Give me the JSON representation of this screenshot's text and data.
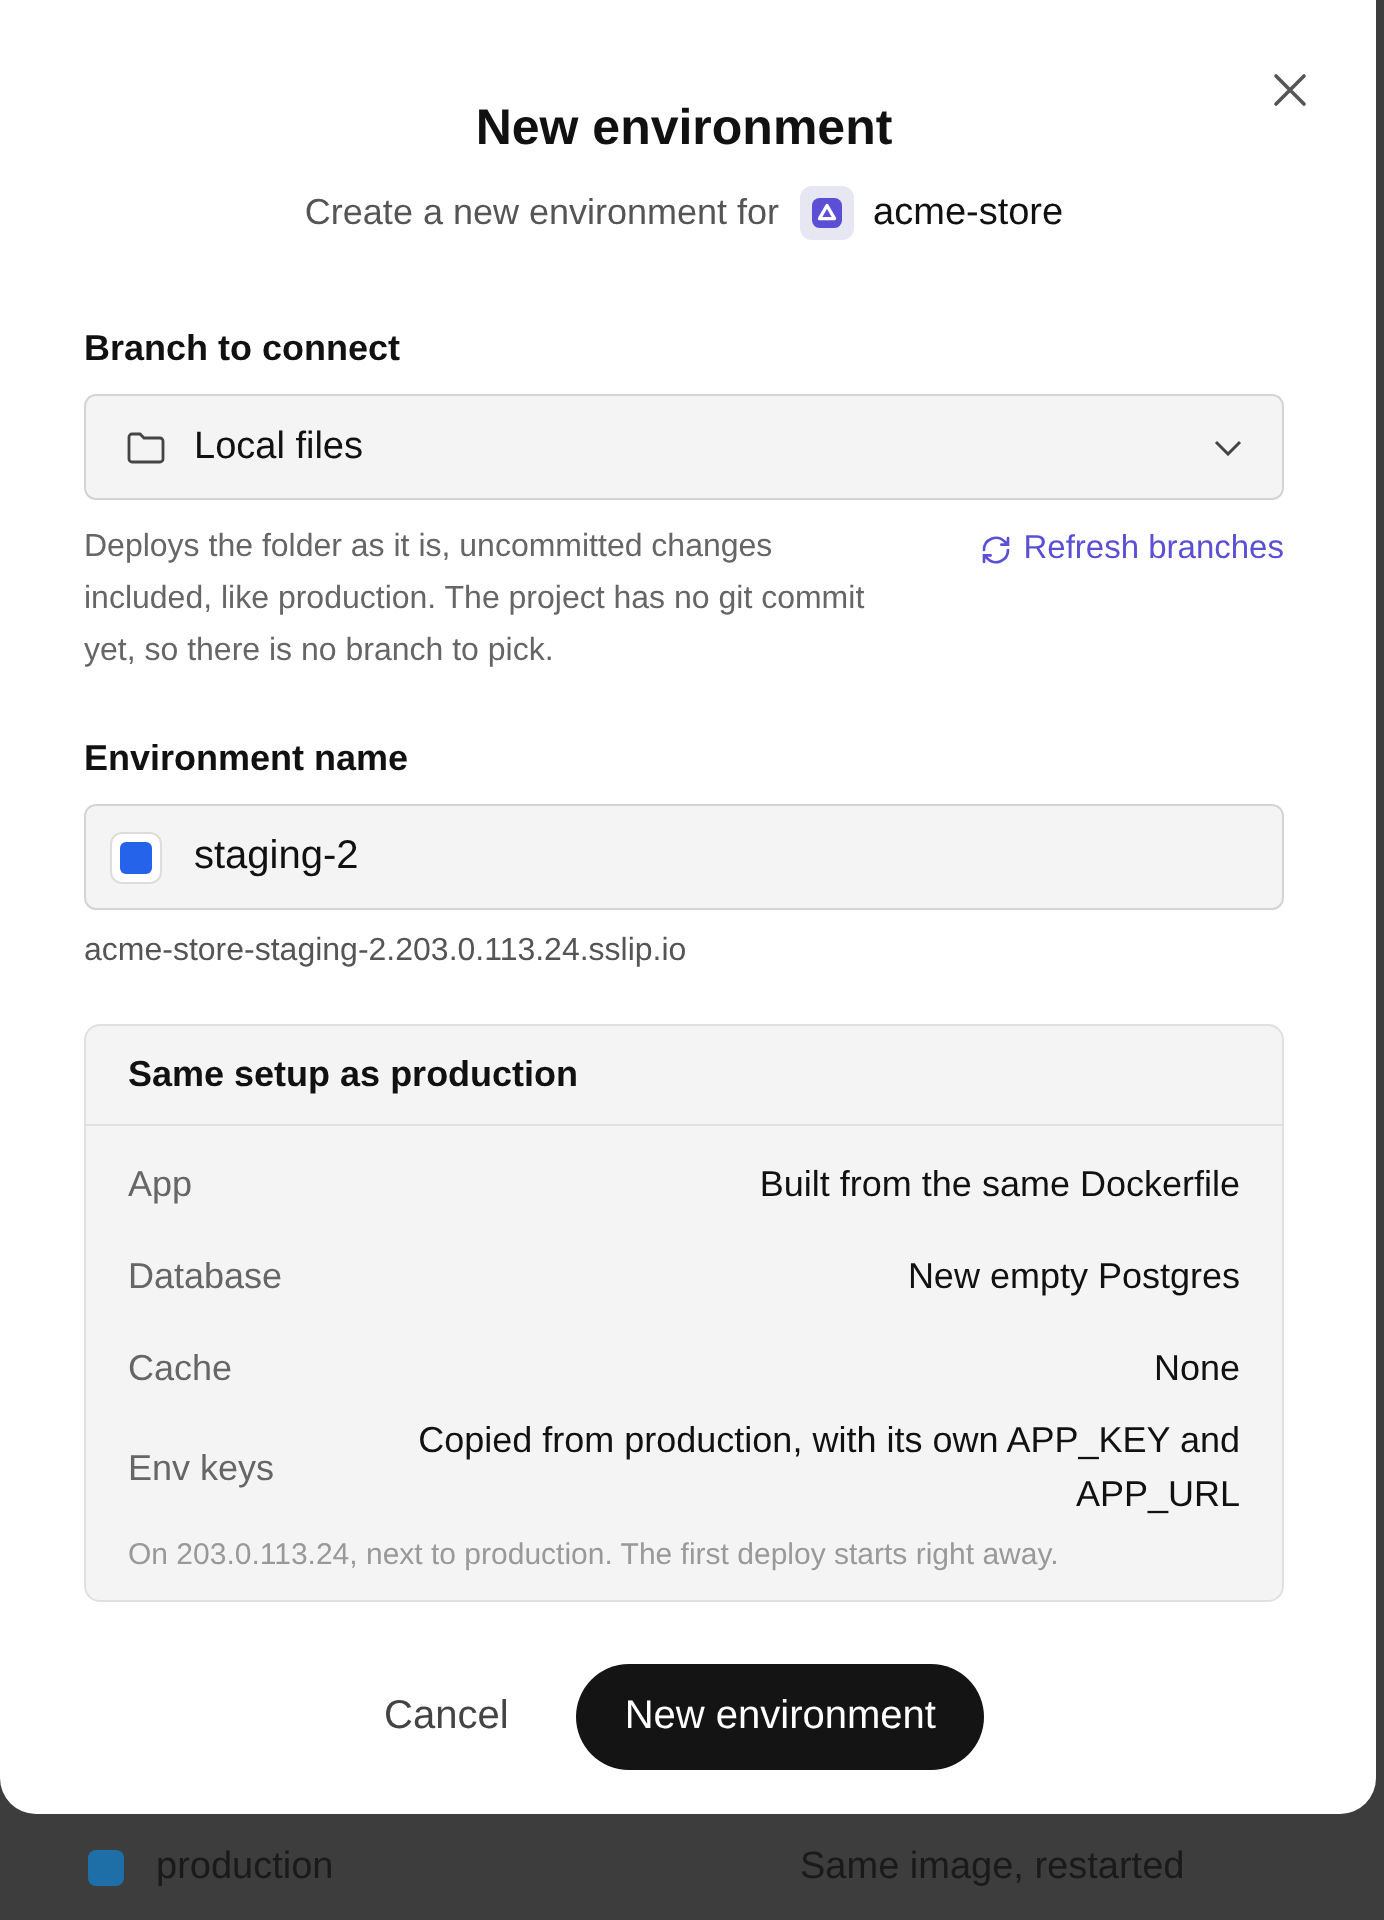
{
  "dialog": {
    "title": "New environment",
    "subtitle": "Create a new environment for",
    "project": "acme-store"
  },
  "branch": {
    "label": "Branch to connect",
    "value": "Local files",
    "hint": "Deploys the folder as it is, uncommitted changes included, like production. The project has no git commit yet, so there is no branch to pick.",
    "refresh": "Refresh branches"
  },
  "environment": {
    "label": "Environment name",
    "value": "staging-2",
    "color": "#2563eb",
    "url": "acme-store-staging-2.203.0.113.24.sslip.io"
  },
  "setup": {
    "title": "Same setup as production",
    "rows": [
      {
        "label": "App",
        "value": "Built from the same Dockerfile"
      },
      {
        "label": "Database",
        "value": "New empty Postgres"
      },
      {
        "label": "Cache",
        "value": "None"
      },
      {
        "label": "Env keys",
        "value": "Copied from production, with its own APP_KEY and APP_URL"
      }
    ],
    "note": "On 203.0.113.24, next to production. The first deploy starts right away."
  },
  "buttons": {
    "cancel": "Cancel",
    "confirm": "New environment"
  },
  "background_row": {
    "name": "production",
    "color": "#1e6fa8",
    "change": "Same image, restarted"
  }
}
